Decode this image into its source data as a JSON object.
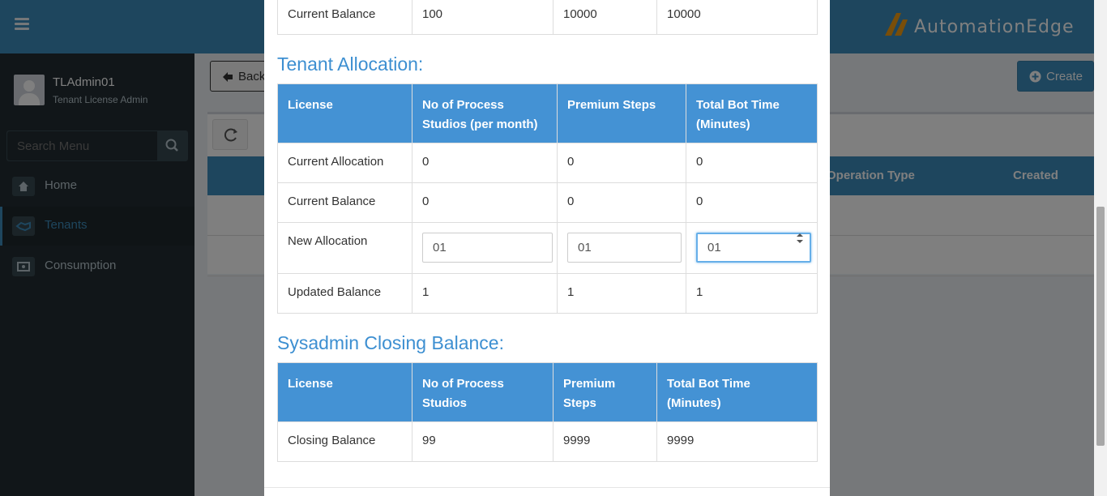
{
  "header": {
    "brand_text": "AutomationEdge",
    "menu_icon": "hamburger-icon",
    "brand_color": "#3c8dbc"
  },
  "user": {
    "name": "TLAdmin01",
    "role": "Tenant License Admin"
  },
  "sidebar": {
    "search_placeholder": "Search Menu",
    "items": [
      {
        "label": "Home",
        "icon": "home-icon"
      },
      {
        "label": "Tenants",
        "icon": "handshake-icon",
        "active": true
      },
      {
        "label": "Consumption",
        "icon": "money-icon"
      }
    ]
  },
  "page": {
    "back_label": "Back",
    "create_label": "Create",
    "columns": [
      "Operation Type",
      "Created"
    ]
  },
  "modal": {
    "top_row": {
      "label": "Current Balance",
      "values": [
        "100",
        "10000",
        "10000"
      ]
    },
    "allocation": {
      "title": "Tenant Allocation:",
      "headers": [
        "License",
        "No of Process Studios (per month)",
        "Premium Steps",
        "Total Bot Time (Minutes)"
      ],
      "rows": [
        {
          "label": "Current Allocation",
          "values": [
            "0",
            "0",
            "0"
          ]
        },
        {
          "label": "Current Balance",
          "values": [
            "0",
            "0",
            "0"
          ]
        }
      ],
      "new_allocation": {
        "label": "New Allocation",
        "values": [
          "01",
          "01",
          "01"
        ]
      },
      "updated_balance": {
        "label": "Updated Balance",
        "values": [
          "1",
          "1",
          "1"
        ]
      }
    },
    "closing": {
      "title": "Sysadmin Closing Balance:",
      "headers": [
        "License",
        "No of Process Studios",
        "Premium Steps",
        "Total Bot Time (Minutes)"
      ],
      "row": {
        "label": "Closing Balance",
        "values": [
          "99",
          "9999",
          "9999"
        ]
      }
    }
  }
}
